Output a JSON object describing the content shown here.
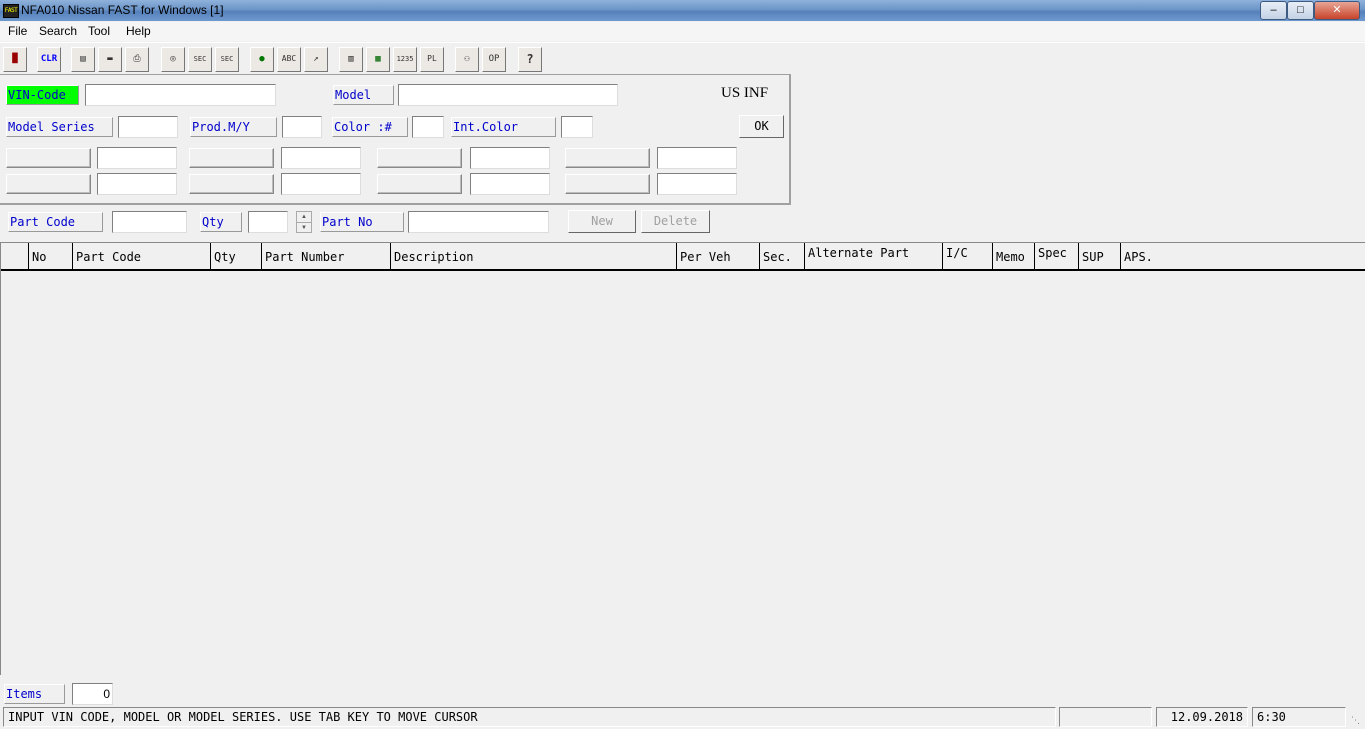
{
  "window": {
    "title": "NFA010 Nissan FAST for Windows [1]",
    "app_icon_text": "FAST",
    "controls": {
      "minimize": "‒",
      "maximize": "□",
      "close": "✕"
    }
  },
  "menu": [
    "File",
    "Search",
    "Tool",
    "Help"
  ],
  "toolbar": {
    "clr_label": "CLR",
    "glyphs": {
      "exit": "█",
      "save": "▤",
      "open": "▬",
      "print": "⎙",
      "find": "◎",
      "sec": "SEC",
      "isec": "SEC",
      "web": "●",
      "abc": "ABC",
      "chart": "↗",
      "book": "▥",
      "clipboard": "▦",
      "num": "1235",
      "pl": "PL",
      "users": "⚇",
      "op": "OP",
      "help": "?"
    }
  },
  "form": {
    "vin_code_label": "VIN-Code",
    "vin_code_value": "",
    "model_label": "Model",
    "model_value": "",
    "region": "US INF",
    "model_series_label": "Model Series",
    "model_series_value": "",
    "prod_my_label": "Prod.M/Y",
    "prod_my_value": "",
    "color_label": "Color :#",
    "color_value": "",
    "int_color_label": "Int.Color",
    "int_color_value": "",
    "ok_label": "OK"
  },
  "entry": {
    "part_code_label": "Part Code",
    "part_code_value": "",
    "qty_label": "Qty",
    "qty_value": "",
    "part_no_label": "Part No",
    "part_no_value": "",
    "new_label": "New",
    "delete_label": "Delete"
  },
  "grid": {
    "columns": [
      "No",
      "Part Code",
      "Qty",
      "Part Number",
      "Description",
      "Per Veh",
      "Sec.",
      "Alternate Part",
      "I/C",
      "Memo",
      "Spec",
      "SUP",
      "APS."
    ],
    "rows": []
  },
  "footer": {
    "items_label": "Items",
    "items_value": "0",
    "status_message": "INPUT VIN CODE, MODEL OR MODEL SERIES. USE TAB KEY TO MOVE CURSOR",
    "status_extra": "",
    "date": "12.09.2018",
    "time": "6:30"
  },
  "colors": {
    "vin_label_bg": "#00ff00",
    "label_text": "#0000cc"
  }
}
